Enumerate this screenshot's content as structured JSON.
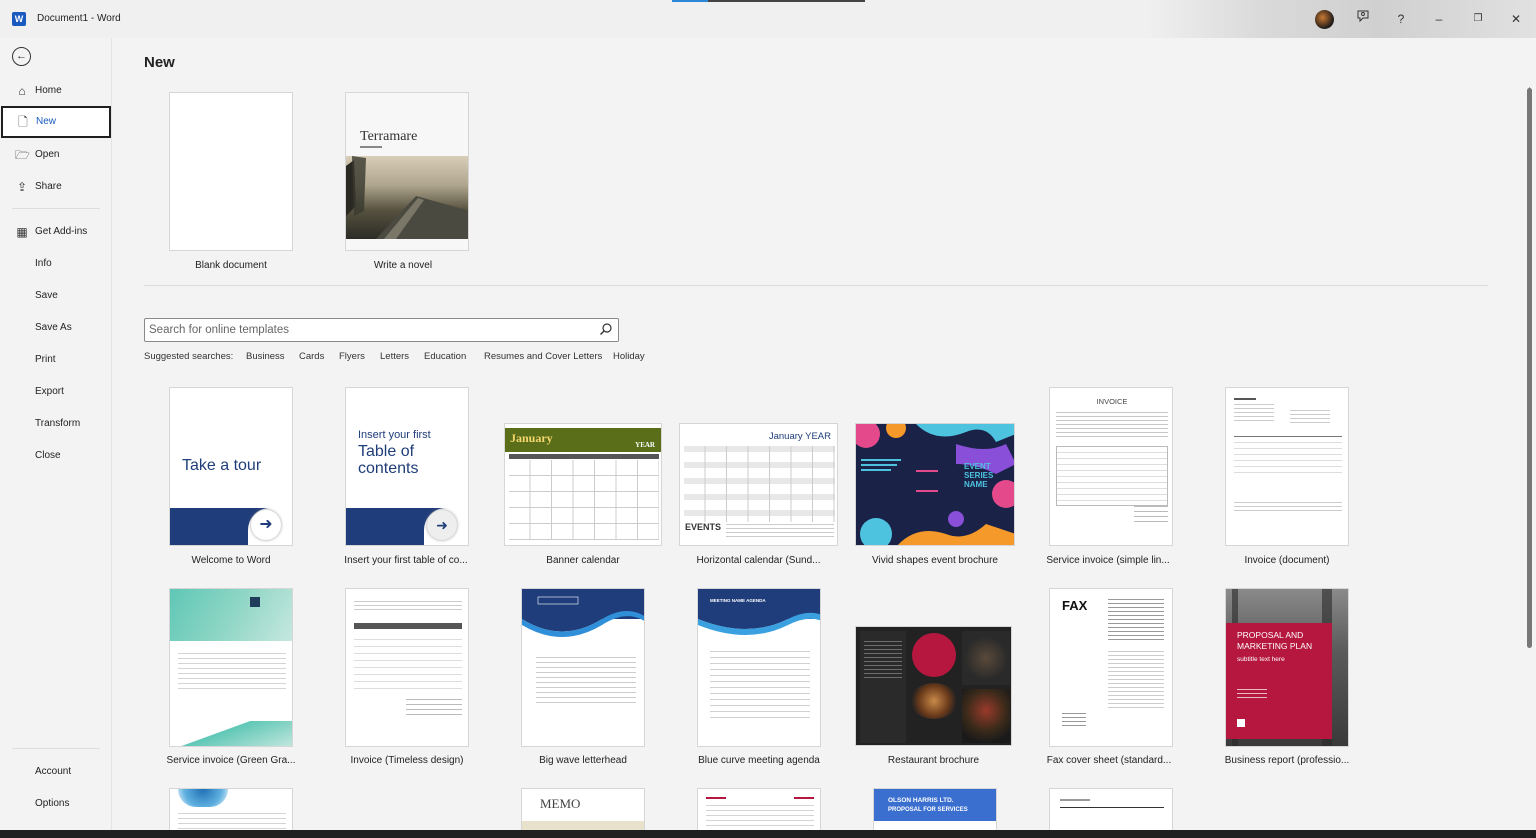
{
  "window": {
    "title": "Document1 - Word",
    "app_icon": "W"
  },
  "titlebar": {
    "icons": [
      "avatar-icon",
      "feedback-icon",
      "help-icon",
      "minimize-icon",
      "restore-icon",
      "close-icon"
    ],
    "help": "?",
    "minimize": "–",
    "restore": "❐",
    "close": "✕"
  },
  "sidebar": {
    "back": "←",
    "items": [
      {
        "label": "Home",
        "icon": "⌂"
      },
      {
        "label": "New",
        "icon": "🗋"
      },
      {
        "label": "Open",
        "icon": "🗁"
      },
      {
        "label": "Share",
        "icon": "⇪"
      },
      {
        "label": "Get Add-ins",
        "icon": "▦"
      },
      {
        "label": "Info"
      },
      {
        "label": "Save"
      },
      {
        "label": "Save As"
      },
      {
        "label": "Print"
      },
      {
        "label": "Export"
      },
      {
        "label": "Transform"
      },
      {
        "label": "Close"
      },
      {
        "label": "Account"
      },
      {
        "label": "Options"
      }
    ]
  },
  "main": {
    "title": "New",
    "featured": [
      {
        "label": "Blank document"
      },
      {
        "label": "Write a novel",
        "heading": "Terramare"
      }
    ],
    "search": {
      "placeholder": "Search for online templates"
    },
    "suggested": {
      "label": "Suggested searches:",
      "items": [
        "Business",
        "Cards",
        "Flyers",
        "Letters",
        "Education",
        "Resumes and Cover Letters",
        "Holiday"
      ]
    },
    "templates": [
      {
        "label": "Welcome to Word",
        "text": "Take a tour"
      },
      {
        "label": "Insert your first table of co...",
        "text1": "Insert your first",
        "text2": "Table of",
        "text3": "contents"
      },
      {
        "label": "Banner calendar",
        "month": "January",
        "year": "YEAR"
      },
      {
        "label": "Horizontal calendar (Sund...",
        "month": "January YEAR",
        "events": "EVENTS"
      },
      {
        "label": "Vivid shapes event brochure",
        "text1": "EVENT",
        "text2": "SERIES",
        "text3": "NAME"
      },
      {
        "label": "Service invoice (simple lin...",
        "text": "INVOICE"
      },
      {
        "label": "Invoice (document)"
      },
      {
        "label": "Service invoice (Green Gra..."
      },
      {
        "label": "Invoice (Timeless design)"
      },
      {
        "label": "Big wave letterhead"
      },
      {
        "label": "Blue curve meeting agenda",
        "text": "MEETING NAME AGENDA"
      },
      {
        "label": "Restaurant brochure"
      },
      {
        "label": "Fax cover sheet (standard...",
        "text": "FAX"
      },
      {
        "label": "Business report (professio...",
        "text1": "PROPOSAL AND",
        "text2": "MARKETING PLAN",
        "text3": "subtitle text here"
      }
    ],
    "row3": {
      "memo": "MEMO",
      "olson1": "OLSON HARRIS LTD.",
      "olson2": "PROPOSAL FOR SERVICES"
    }
  },
  "colors": {
    "accent": "#185abd",
    "navy": "#1f3d7a",
    "green": "#5a6e1a",
    "crimson": "#b5173f"
  }
}
